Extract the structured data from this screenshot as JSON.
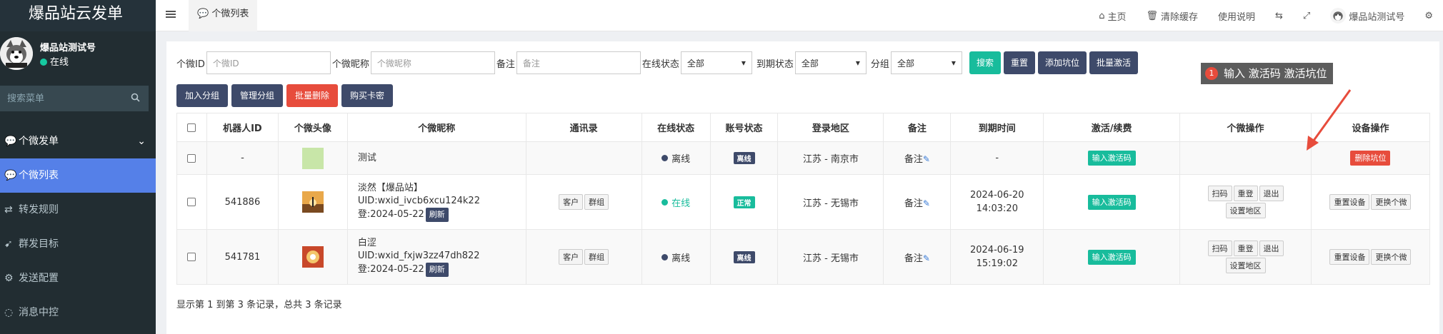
{
  "brand": {
    "title": "爆品站云发单"
  },
  "user": {
    "name": "爆品站测试号",
    "status": "在线"
  },
  "sidebar": {
    "search_placeholder": "搜索菜单",
    "items": [
      {
        "label": "个微发单",
        "icon": "wechat-icon"
      },
      {
        "label": "个微列表",
        "icon": "wechat-icon"
      },
      {
        "label": "转发规则",
        "icon": "retweet-icon"
      },
      {
        "label": "群发目标",
        "icon": "rocket-icon"
      },
      {
        "label": "发送配置",
        "icon": "gear-icon"
      },
      {
        "label": "消息中控",
        "icon": "chat-icon"
      }
    ]
  },
  "navbar": {
    "tab_label": "个微列表",
    "home": "主页",
    "clear_cache": "清除缓存",
    "help": "使用说明",
    "account": "爆品站测试号"
  },
  "filters": {
    "id_label": "个微ID",
    "id_placeholder": "个微ID",
    "nick_label": "个微昵称",
    "nick_placeholder": "个微昵称",
    "remark_label": "备注",
    "remark_placeholder": "备注",
    "online_label": "在线状态",
    "online_value": "全部",
    "expire_label": "到期状态",
    "expire_value": "全部",
    "group_label": "分组",
    "group_value": "全部",
    "search": "搜索",
    "reset": "重置",
    "add_slot": "添加坑位",
    "batch_activate": "批量激活"
  },
  "actions": {
    "add_group": "加入分组",
    "manage_group": "管理分组",
    "batch_delete": "批量删除",
    "buy_card": "购买卡密"
  },
  "tooltip": {
    "number": "1",
    "text": "输入 激活码  激活坑位"
  },
  "table": {
    "headers": [
      "机器人ID",
      "个微头像",
      "个微昵称",
      "通讯录",
      "在线状态",
      "账号状态",
      "登录地区",
      "备注",
      "到期时间",
      "激活/续费",
      "个微操作",
      "设备操作"
    ],
    "rows": [
      {
        "id": "-",
        "nick": "测试",
        "uid": "",
        "login": "",
        "online": "离线",
        "account": "离线",
        "region": "江苏 - 南京市",
        "remark": "备注",
        "expire_date": "-",
        "expire_time": "",
        "activate": "输入激活码",
        "device": [
          "删除坑位"
        ]
      },
      {
        "id": "541886",
        "nick": "淡然【爆品站】",
        "uid": "UID:wxid_ivcb6xcu124k22",
        "login": "登:2024-05-22",
        "contacts": [
          "客户",
          "群组"
        ],
        "online": "在线",
        "account": "正常",
        "region": "江苏 - 无锡市",
        "remark": "备注",
        "expire_date": "2024-06-20",
        "expire_time": "14:03:20",
        "activate": "输入激活码",
        "wx_ops": [
          "扫码",
          "重登",
          "退出",
          "设置地区"
        ],
        "device": [
          "重置设备",
          "更换个微"
        ]
      },
      {
        "id": "541781",
        "nick": "白涩",
        "uid": "UID:wxid_fxjw3zz47dh822",
        "login": "登:2024-05-22",
        "contacts": [
          "客户",
          "群组"
        ],
        "online": "离线",
        "account": "离线",
        "region": "江苏 - 无锡市",
        "remark": "备注",
        "expire_date": "2024-06-19",
        "expire_time": "15:19:02",
        "activate": "输入激活码",
        "wx_ops": [
          "扫码",
          "重登",
          "退出",
          "设置地区"
        ],
        "device": [
          "重置设备",
          "更换个微"
        ]
      }
    ],
    "refresh": "刷新"
  },
  "footer": {
    "text": "显示第 1 到第 3 条记录，总共 3 条记录"
  },
  "colors": {
    "sidebar": "#222d32",
    "active": "#5580e8",
    "teal": "#18bc9c",
    "dark": "#3e4a6a",
    "red": "#e74c3c"
  }
}
